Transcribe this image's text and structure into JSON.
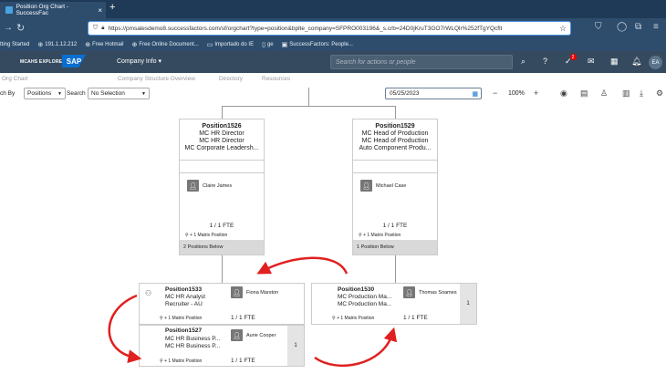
{
  "browser": {
    "tab_title": "Position Org Chart - SuccessFac",
    "url": "https://pmsalesdemo8.successfactors.com/sf/orgchart?type=position&bplte_company=SFPRO003196&_s.crb=24D0jKruT3GO7rWLQlr%252fTgYQcflt",
    "bookmarks": [
      {
        "icon": "globe-icon",
        "label": "tting Started"
      },
      {
        "icon": "globe-icon",
        "label": "191.1.12.212"
      },
      {
        "icon": "globe-icon",
        "label": "Free Hotmail"
      },
      {
        "icon": "globe-icon",
        "label": "Free Online Document..."
      },
      {
        "icon": "folder-icon",
        "label": "Importado do IE"
      },
      {
        "icon": "page-icon",
        "label": "ge"
      },
      {
        "icon": "sf-icon",
        "label": "SuccessFactors: People..."
      }
    ]
  },
  "shell": {
    "brand": "MCAHS EXPLORE",
    "logo": "SAP",
    "menu": "Company Info",
    "search_placeholder": "Search for actions or people",
    "notification_count": "2",
    "avatar_initials": "EA"
  },
  "subnav": [
    "Org Chart",
    "Company Structure Overview",
    "Directory",
    "Resources"
  ],
  "toolbar": {
    "search_by_label": "ch By",
    "search_by_value": "Positions",
    "search_label": "Search",
    "search_value": "No Selection",
    "date": "05/25/2023",
    "zoom": "100%"
  },
  "cards": [
    {
      "id": "Position1526",
      "title1": "MC HR Director",
      "title2": "MC HR Director",
      "title3": "MC Corporate Leadersh...",
      "person": "Claire James",
      "fte": "1 / 1 FTE",
      "matrix": "+ 1 Matrix Position",
      "below": "2 Positions Below"
    },
    {
      "id": "Position1529",
      "title1": "MC Head of Production",
      "title2": "MC Head of Production",
      "title3": "Auto Component Produ...",
      "person": "Michael Case",
      "fte": "1 / 1 FTE",
      "matrix": "+ 1 Matrix Position",
      "below": "1 Position Below"
    }
  ],
  "children": [
    {
      "id": "Position1533",
      "title1": "MC HR Analyst",
      "title2": "Recruiter - AU",
      "person": "Fiona Marston",
      "matrix": "+ 1 Matrix Position",
      "fte": "1 / 1 FTE"
    },
    {
      "id": "Position1527",
      "title1": "MC HR Business P...",
      "title2": "MC HR Business P...",
      "person": "Aurie Cooper",
      "matrix": "+ 1 Matrix Position",
      "fte": "1 / 1 FTE",
      "count": "1"
    },
    {
      "id": "Position1530",
      "title1": "MC Production Ma...",
      "title2": "MC Production Ma...",
      "person": "Thomas Soames",
      "matrix": "+ 1 Matrix Position",
      "fte": "1 / 1 FTE",
      "count": "1"
    }
  ],
  "colors": {
    "annotation_arrow": "#e02020",
    "shell": "#354a5f",
    "accent": "#0a6ed1"
  }
}
